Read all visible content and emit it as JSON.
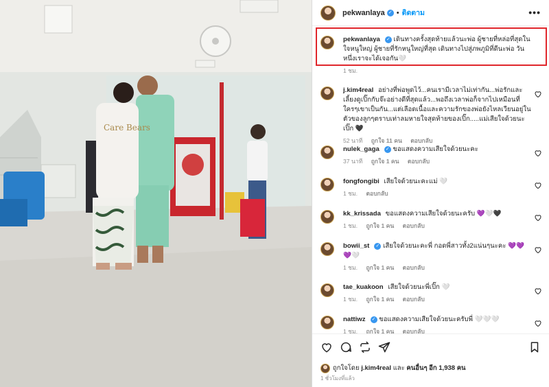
{
  "header": {
    "username": "pekwanlaya",
    "separator": "•",
    "follow_label": "ติดตาม",
    "more_label": "•••"
  },
  "photo": {
    "shirt_text": "Care Bears"
  },
  "caption": {
    "username": "pekwanlaya",
    "text": "เดินทางครั้งสุดท้ายแล้วนะพ่อ ผู้ชายที่หล่อที่สุดในใจหนูใหญ่ ผู้ชายที่รักหนูใหญ่ที่สุด เดินทางไปสู่ภพภูมิที่ดีนะพ่อ วันหนึ่งเราจะได้เจอกัน🤍",
    "time": "1 ชม."
  },
  "comments": [
    {
      "username": "j.kim4real",
      "verified": false,
      "text": "อย่างที่พ่อพูดไว้...คนเรามีเวลาไม่เท่ากัน...พ่อรักและเลี้ยงดูเปิ๊กกับจ๊ะอย่างดีที่สุดแล้ว...พอถึงเวลาพ่อก็จากไปเหมือนที่ใครๆเขาเป็นกัน...แต่เลือดเนื้อและความรักของพ่อยังไหลเวียนอยู่ในตัวของลูกๆตราบเท่าลมหายใจสุดท้ายของเปิ๊ก.....แม่เสียใจด้วยนะเปิ๊ก 🖤",
      "time": "52 นาที",
      "likes": "ถูกใจ 11 คน",
      "reply": "ตอบกลับ"
    },
    {
      "username": "nulek_gaga",
      "verified": true,
      "text": "ขอแสดงความเสียใจด้วยนะคะ",
      "time": "37 นาที",
      "likes": "ถูกใจ 1 คน",
      "reply": "ตอบกลับ"
    },
    {
      "username": "fongfongibi",
      "verified": false,
      "text": "เสียใจด้วยนะคะแม่ 🤍",
      "time": "1 ชม.",
      "likes": "",
      "reply": "ตอบกลับ"
    },
    {
      "username": "kk_krissada",
      "verified": false,
      "text": "ขอแสดงความเสียใจด้วยนะครับ 💜🤍🖤",
      "time": "1 ชม.",
      "likes": "ถูกใจ 1 คน",
      "reply": "ตอบกลับ"
    },
    {
      "username": "bowii_st",
      "verified": true,
      "text": "เสียใจด้วยนะคะพี่ กอดพี่สาวทั้ง2แน่นๆนะคะ 💜💜💜🤍",
      "time": "1 ชม.",
      "likes": "ถูกใจ 1 คน",
      "reply": "ตอบกลับ"
    },
    {
      "username": "tae_kuakoon",
      "verified": false,
      "text": "เสียใจด้วยนะพี่เปิ๊ก 🤍",
      "time": "1 ชม.",
      "likes": "ถูกใจ 1 คน",
      "reply": "ตอบกลับ"
    },
    {
      "username": "nattiwz",
      "verified": true,
      "text": "ขอแสดงความเสียใจด้วยนะครับพี่ 🤍🤍🤍",
      "time": "1 ชม.",
      "likes": "ถูกใจ 1 คน",
      "reply": "ตอบกลับ"
    }
  ],
  "footer": {
    "liked_by_prefix": "ถูกใจโดย",
    "liked_by_user": "j.kim4real",
    "liked_by_and": "และ",
    "liked_by_others": "คนอื่นๆ อีก 1,938 คน",
    "posted_time": "1 ชั่วโมงที่แล้ว"
  },
  "icons": [
    "heart-icon",
    "comment-icon",
    "repost-icon",
    "share-icon",
    "bookmark-icon",
    "verified-icon",
    "more-icon"
  ],
  "colors": {
    "accent_blue": "#0095f6",
    "highlight_red": "#e0262b",
    "verified_blue": "#3897f0",
    "meta_gray": "#8e8e8e"
  }
}
